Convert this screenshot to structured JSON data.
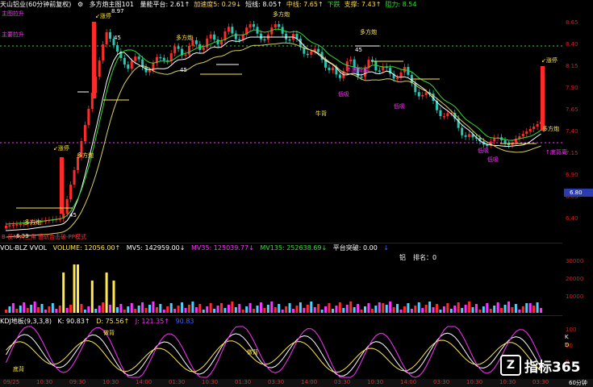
{
  "header": {
    "title": "天山铝业(60分钟前复权)",
    "indicator": "多方炮主图101",
    "fields": [
      {
        "label": "量能平台",
        "value": "2.61↑",
        "color": "#ffffff"
      },
      {
        "label": "加速度5",
        "value": "0.29↓",
        "color": "#ffd84a"
      },
      {
        "label": "短线",
        "value": "8.05↑",
        "color": "#ffffff"
      },
      {
        "label": "中线",
        "value": "7.65↑",
        "color": "#ffd84a"
      },
      {
        "label": "下跌",
        "value": "",
        "color": "#33dd33"
      },
      {
        "label": "支撑",
        "value": "7.43↑",
        "color": "#ffd84a"
      },
      {
        "label": "阻力",
        "value": "8.54",
        "color": "#33dd33"
      }
    ],
    "main_up": "主图拉升",
    "main_down": "主要拉升"
  },
  "price_axis": {
    "ticks": [
      "8.65",
      "8.40",
      "8.15",
      "7.90",
      "7.65",
      "7.40",
      "7.15",
      "6.90",
      "6.65",
      "6.40"
    ],
    "current_price": "6.80"
  },
  "main_labels": {
    "zhangting": "↙涨停",
    "duofangpao": "多方炮",
    "buy45": "45",
    "dijin": "低吸",
    "niushi": "牛背",
    "weilou": "低吸",
    "zhuli": "↑底背离",
    "low_price": "6.33",
    "high_price": "8.97",
    "bottom_note": "B-反N 大三角 慢轨合击破-PP模式"
  },
  "volume_header": {
    "name": "VOL-BLZ VVOL",
    "volume": "VOLUME: 12056.00↑",
    "mv5": "MV5: 142959.00↓",
    "mv35": "MV35: 125039.77↓",
    "mv135": "MV135: 252638.69↓",
    "platform": "平台突破: 0.00",
    "extra": "↓"
  },
  "volume_center": {
    "name": "铝",
    "rank": "排名：0"
  },
  "volume_axis": [
    "30000",
    "20000",
    "10000"
  ],
  "kdj_header": {
    "name": "KDJ地板(9,3,3,8)",
    "k": "K: 90.83↑",
    "d": "D: 75.56↑",
    "j": "J: 121.35↑",
    "extra": "90.83"
  },
  "kdj_labels": {
    "cao": "做背",
    "di": "底背",
    "kline": "K",
    "dline": "D"
  },
  "kdj_axis": [
    "100",
    "50",
    "0"
  ],
  "time_axis": [
    "09/25",
    "10:30",
    "09:30",
    "10:30",
    "14:00",
    "01:30",
    "10:30",
    "01:30",
    "03:30",
    "14:00",
    "03:30",
    "10:30",
    "14:00",
    "03:30",
    "10:30",
    "10:30",
    "03:30"
  ],
  "period": "60分钟",
  "logo": {
    "mark": "Z",
    "text": "指标365"
  },
  "colors": {
    "up": "#ff2a2a",
    "down": "#2bc4b4",
    "yellow": "#ffe84a",
    "magenta": "#ff33ff",
    "white": "#ffffff",
    "green": "#33dd33"
  }
}
